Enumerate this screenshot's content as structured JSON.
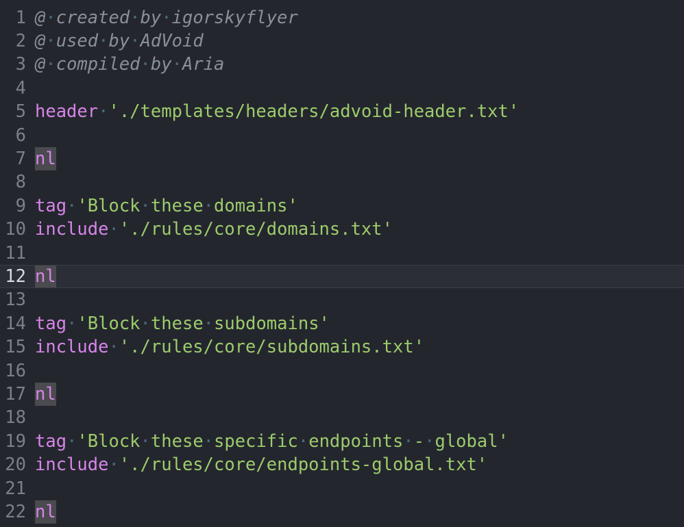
{
  "editor": {
    "lines": [
      {
        "n": "1",
        "segments": [
          [
            "comment",
            "@"
          ],
          [
            "ws",
            "·"
          ],
          [
            "comment",
            "created"
          ],
          [
            "ws",
            "·"
          ],
          [
            "comment",
            "by"
          ],
          [
            "ws",
            "·"
          ],
          [
            "comment",
            "igorskyflyer"
          ]
        ]
      },
      {
        "n": "2",
        "segments": [
          [
            "comment",
            "@"
          ],
          [
            "ws",
            "·"
          ],
          [
            "comment",
            "used"
          ],
          [
            "ws",
            "·"
          ],
          [
            "comment",
            "by"
          ],
          [
            "ws",
            "·"
          ],
          [
            "comment",
            "AdVoid"
          ]
        ]
      },
      {
        "n": "3",
        "segments": [
          [
            "comment",
            "@"
          ],
          [
            "ws",
            "·"
          ],
          [
            "comment",
            "compiled"
          ],
          [
            "ws",
            "·"
          ],
          [
            "comment",
            "by"
          ],
          [
            "ws",
            "·"
          ],
          [
            "comment",
            "Aria"
          ]
        ]
      },
      {
        "n": "4",
        "segments": []
      },
      {
        "n": "5",
        "segments": [
          [
            "kw",
            "header"
          ],
          [
            "ws",
            "·"
          ],
          [
            "str",
            "'./templates/headers/advoid-header.txt'"
          ]
        ]
      },
      {
        "n": "6",
        "segments": []
      },
      {
        "n": "7",
        "segments": [
          [
            "nl",
            "nl"
          ]
        ]
      },
      {
        "n": "8",
        "segments": []
      },
      {
        "n": "9",
        "segments": [
          [
            "kw",
            "tag"
          ],
          [
            "ws",
            "·"
          ],
          [
            "str",
            "'Block"
          ],
          [
            "ws",
            "·"
          ],
          [
            "str",
            "these"
          ],
          [
            "ws",
            "·"
          ],
          [
            "str",
            "domains'"
          ]
        ]
      },
      {
        "n": "10",
        "segments": [
          [
            "kw",
            "include"
          ],
          [
            "ws",
            "·"
          ],
          [
            "str",
            "'./rules/core/domains.txt'"
          ]
        ]
      },
      {
        "n": "11",
        "segments": []
      },
      {
        "n": "12",
        "active": true,
        "segments": [
          [
            "nl",
            "nl"
          ]
        ]
      },
      {
        "n": "13",
        "segments": []
      },
      {
        "n": "14",
        "segments": [
          [
            "kw",
            "tag"
          ],
          [
            "ws",
            "·"
          ],
          [
            "str",
            "'Block"
          ],
          [
            "ws",
            "·"
          ],
          [
            "str",
            "these"
          ],
          [
            "ws",
            "·"
          ],
          [
            "str",
            "subdomains'"
          ]
        ]
      },
      {
        "n": "15",
        "segments": [
          [
            "kw",
            "include"
          ],
          [
            "ws",
            "·"
          ],
          [
            "str",
            "'./rules/core/subdomains.txt'"
          ]
        ]
      },
      {
        "n": "16",
        "segments": []
      },
      {
        "n": "17",
        "segments": [
          [
            "nl",
            "nl"
          ]
        ]
      },
      {
        "n": "18",
        "segments": []
      },
      {
        "n": "19",
        "segments": [
          [
            "kw",
            "tag"
          ],
          [
            "ws",
            "·"
          ],
          [
            "str",
            "'Block"
          ],
          [
            "ws",
            "·"
          ],
          [
            "str",
            "these"
          ],
          [
            "ws",
            "·"
          ],
          [
            "str",
            "specific"
          ],
          [
            "ws",
            "·"
          ],
          [
            "str",
            "endpoints"
          ],
          [
            "ws",
            "·"
          ],
          [
            "str",
            "-"
          ],
          [
            "ws",
            "·"
          ],
          [
            "str",
            "global'"
          ]
        ]
      },
      {
        "n": "20",
        "segments": [
          [
            "kw",
            "include"
          ],
          [
            "ws",
            "·"
          ],
          [
            "str",
            "'./rules/core/endpoints-global.txt'"
          ]
        ]
      },
      {
        "n": "21",
        "segments": []
      },
      {
        "n": "22",
        "segments": [
          [
            "nl",
            "nl"
          ]
        ]
      }
    ]
  },
  "colors": {
    "background": "#24262e",
    "keyword": "#d685e8",
    "string": "#9ccc6b",
    "comment": "#8a8f98",
    "line_number": "#7c8089"
  }
}
